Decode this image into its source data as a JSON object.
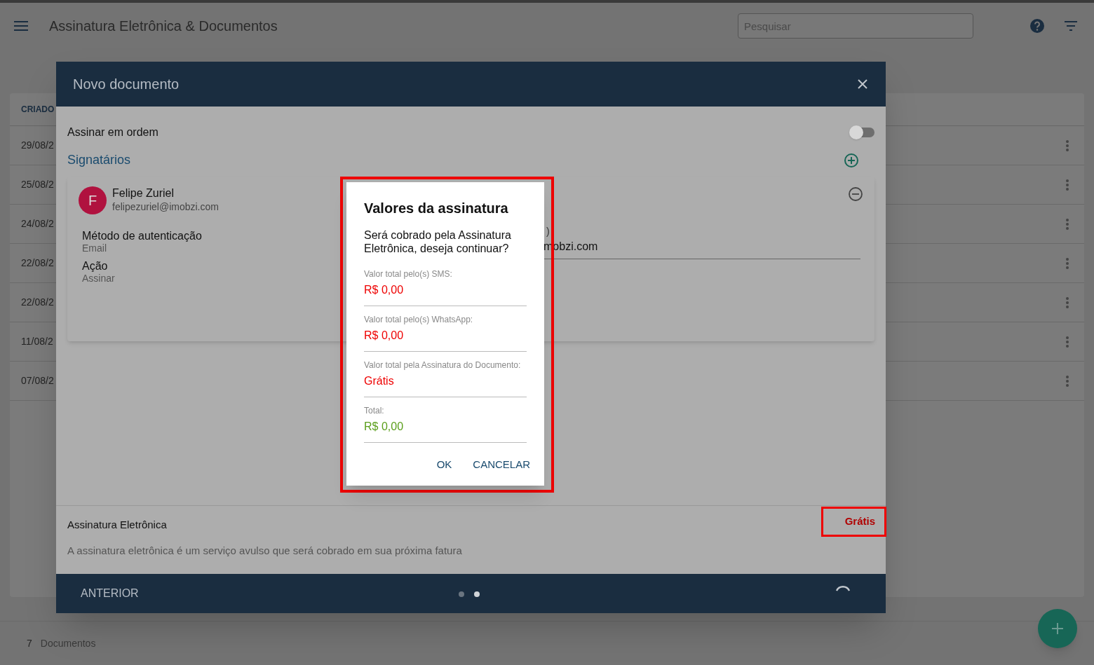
{
  "app_bar": {
    "title": "Assinatura Eletrônica & Documentos",
    "search": {
      "placeholder": "Pesquisar"
    }
  },
  "table": {
    "columns": [
      "CRIADO"
    ],
    "rows": [
      {
        "date": "29/08/2"
      },
      {
        "date": "25/08/2"
      },
      {
        "date": "24/08/2"
      },
      {
        "date": "22/08/2"
      },
      {
        "date": "22/08/2"
      },
      {
        "date": "11/08/2"
      },
      {
        "date": "07/08/2"
      }
    ]
  },
  "footer": {
    "count": "7",
    "label": "Documentos"
  },
  "modal": {
    "title": "Novo documento",
    "sign_in_order": {
      "label": "Assinar em ordem",
      "on": false
    },
    "signers_heading": "Signatários",
    "signers": [
      {
        "initial": "F",
        "name": "Felipe Zuriel",
        "email": "felipezuriel@imobzi.com",
        "fields": [
          {
            "label": "Método de autenticação",
            "value": "Email"
          },
          {
            "label": "Ação",
            "value": "Assinar"
          }
        ],
        "column_2_label": ")",
        "column_2_value": "mobzi.com"
      }
    ],
    "service": {
      "title": "Assinatura Eletrônica",
      "price": "Grátis",
      "description": "A assinatura eletrônica é um serviço avulso que será cobrado em sua próxima fatura"
    },
    "nav": {
      "back": "ANTERIOR",
      "steps": [
        {
          "selected": false
        },
        {
          "selected": true
        }
      ]
    }
  },
  "dialog": {
    "title": "Valores da assinatura",
    "message": "Será cobrado pela Assinatura Eletrônica, deseja continuar?",
    "items": [
      {
        "label": "Valor total pelo(s) SMS:",
        "value": "R$ 0,00",
        "kind": "charge"
      },
      {
        "label": "Valor total pelo(s) WhatsApp:",
        "value": "R$ 0,00",
        "kind": "charge"
      },
      {
        "label": "Valor total pela Assinatura do Documento:",
        "value": "Grátis",
        "kind": "charge"
      },
      {
        "label": "Total:",
        "value": "R$ 0,00",
        "kind": "total"
      }
    ],
    "buttons": [
      "OK",
      "CANCELAR"
    ]
  }
}
